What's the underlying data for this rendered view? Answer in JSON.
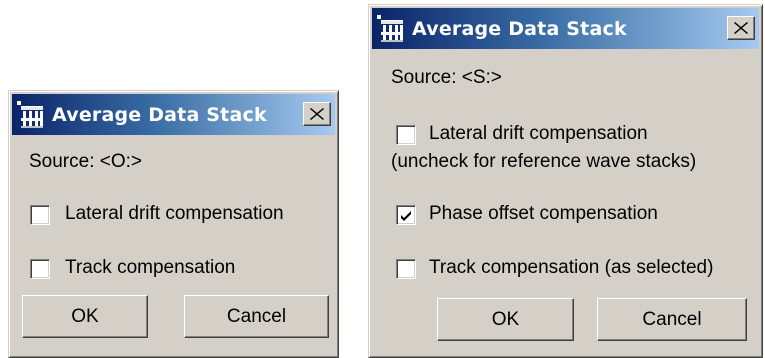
{
  "colors": {
    "dialog_face": "#d4d0c8",
    "title_gradient_start": "#0a246a",
    "title_gradient_end": "#a6caf0",
    "title_text": "#ffffff",
    "checkbox_bg": "#ffffff"
  },
  "dialog_small": {
    "title": "Average Data Stack",
    "title_icon": "average-stack-app-icon",
    "close_icon": "close-icon",
    "source_text": "Source:  <O:>",
    "options": [
      {
        "label": "Lateral drift compensation",
        "checked": false
      },
      {
        "label": "Track compensation",
        "checked": false
      }
    ],
    "ok_label": "OK",
    "cancel_label": "Cancel"
  },
  "dialog_large": {
    "title": "Average Data Stack",
    "title_icon": "average-stack-app-icon",
    "close_icon": "close-icon",
    "source_text": "Source:  <S:>",
    "options": [
      {
        "label": "Lateral drift compensation",
        "sublabel": "(uncheck for reference wave stacks)",
        "checked": false
      },
      {
        "label": "Phase offset compensation",
        "checked": true
      },
      {
        "label": "Track compensation (as selected)",
        "checked": false
      }
    ],
    "ok_label": "OK",
    "cancel_label": "Cancel"
  }
}
